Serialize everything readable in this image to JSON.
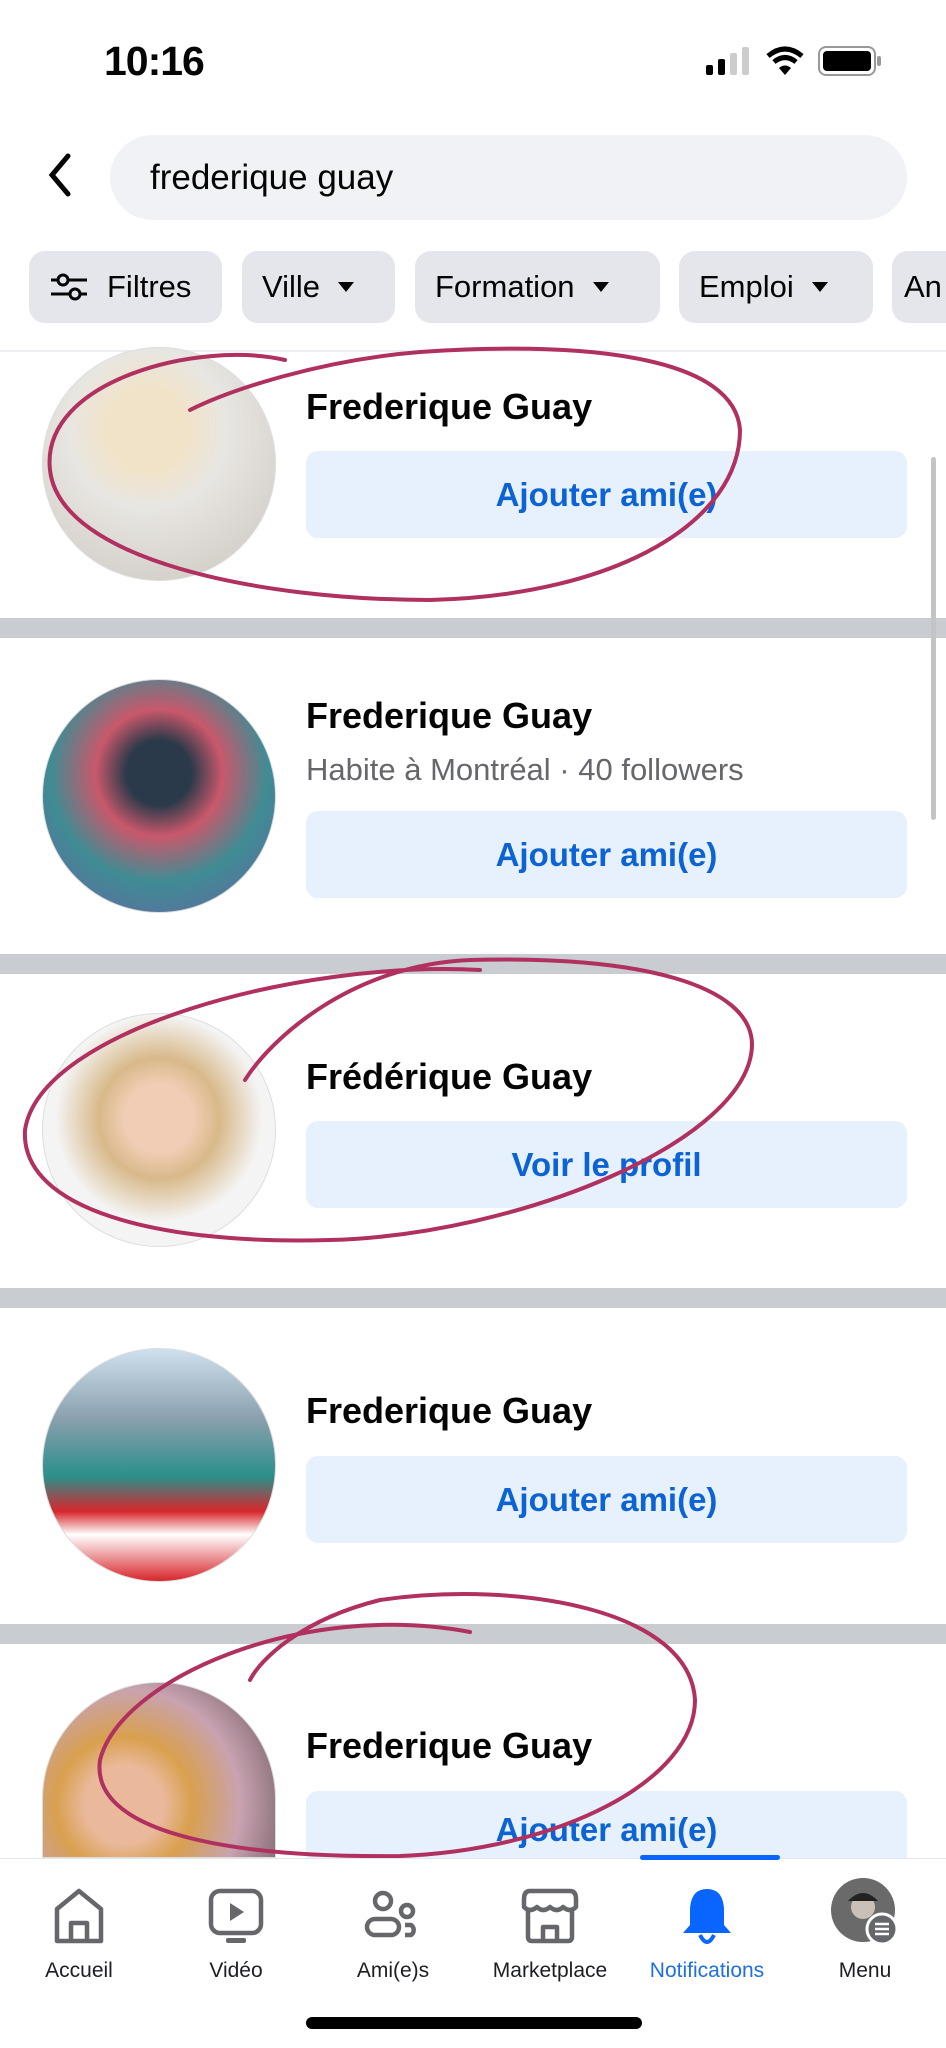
{
  "status_bar": {
    "time": "10:16",
    "signal": "signal-icon",
    "wifi": "wifi-icon",
    "battery": "battery-icon"
  },
  "search": {
    "value": "frederique guay"
  },
  "filters": [
    {
      "label": "Filtres",
      "icon": "sliders-icon"
    },
    {
      "label": "Ville"
    },
    {
      "label": "Formation"
    },
    {
      "label": "Emploi"
    },
    {
      "label": "An"
    }
  ],
  "results": [
    {
      "name": "Frederique Guay",
      "subtitle": "",
      "button": "Ajouter ami(e)"
    },
    {
      "name": "Frederique Guay",
      "subtitle": "Habite à Montréal · 40 followers",
      "button": "Ajouter ami(e)"
    },
    {
      "name": "Frédérique Guay",
      "subtitle": "",
      "button": "Voir le profil"
    },
    {
      "name": "Frederique Guay",
      "subtitle": "",
      "button": "Ajouter ami(e)"
    },
    {
      "name": "Frederique Guay",
      "subtitle": "",
      "button": "Ajouter ami(e)"
    }
  ],
  "nav": [
    {
      "label": "Accueil",
      "icon": "home-icon"
    },
    {
      "label": "Vidéo",
      "icon": "video-icon"
    },
    {
      "label": "Ami(e)s",
      "icon": "friends-icon"
    },
    {
      "label": "Marketplace",
      "icon": "marketplace-icon"
    },
    {
      "label": "Notifications",
      "icon": "bell-icon",
      "active": true
    },
    {
      "label": "Menu",
      "icon": "avatar-menu-icon"
    }
  ],
  "colors": {
    "accent": "#0866ff",
    "button_bg": "#e7f0fd",
    "annotation": "#b0305f"
  }
}
